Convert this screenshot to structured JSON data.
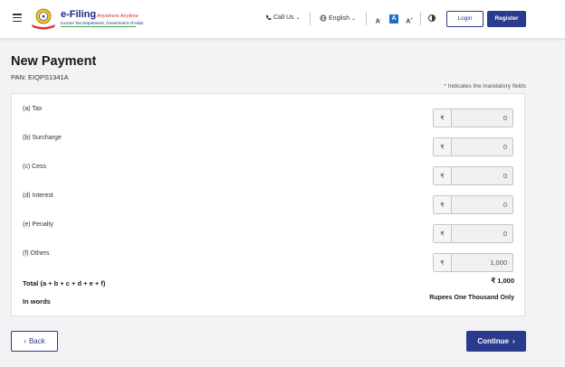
{
  "header": {
    "brand_main": "e-Filing",
    "brand_tagline": "Anywhere Anytime",
    "brand_sub": "Income Tax Department, Government of India",
    "call_us": "Call Us",
    "language": "English",
    "font_decrease": "A",
    "font_default": "A",
    "font_increase": "A",
    "login_label": "Login",
    "register_label": "Register"
  },
  "page": {
    "title": "New Payment",
    "pan_label": "PAN:",
    "pan_value": "EIQPS1341A",
    "mandatory_star": "*",
    "mandatory_note": "Indicates the mandatory fields"
  },
  "currency_symbol": "₹",
  "rows": [
    {
      "label": "(a) Tax",
      "value": "0"
    },
    {
      "label": "(b) Surcharge",
      "value": "0"
    },
    {
      "label": "(c) Cess",
      "value": "0"
    },
    {
      "label": "(d) Interest",
      "value": "0"
    },
    {
      "label": "(e) Penalty",
      "value": "0"
    },
    {
      "label": "(f) Others",
      "value": "1,000"
    }
  ],
  "total": {
    "label": "Total (a + b + c + d + e + f)",
    "value": "₹ 1,000"
  },
  "words": {
    "label": "In words",
    "value": "Rupees One Thousand Only"
  },
  "footer": {
    "back_label": "Back",
    "continue_label": "Continue"
  },
  "colors": {
    "primary": "#2a3a8c",
    "mandatory_star": "#d32f2f",
    "page_bg": "#f3f3f5"
  }
}
